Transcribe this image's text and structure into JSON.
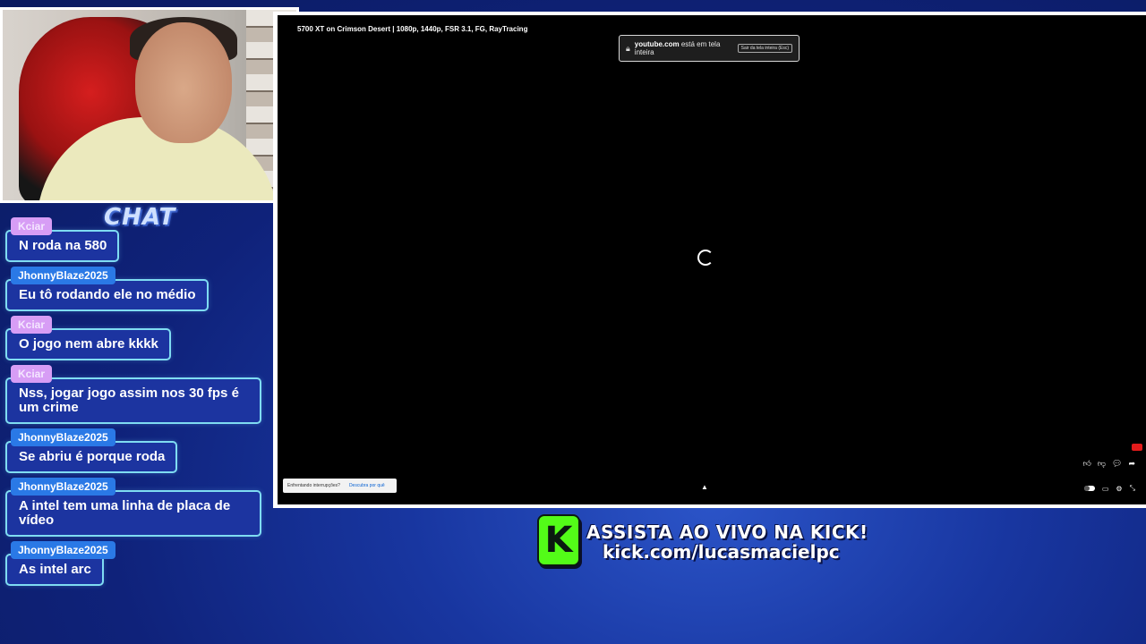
{
  "chat": {
    "title": "CHAT",
    "messages": [
      {
        "user": "Kciar",
        "text": "N roda na 580"
      },
      {
        "user": "JhonnyBlaze2025",
        "text": "Eu tô rodando ele no médio"
      },
      {
        "user": "Kciar",
        "text": "O jogo nem abre kkkk"
      },
      {
        "user": "Kciar",
        "text": "Nss, jogar jogo assim nos 30 fps é um crime"
      },
      {
        "user": "JhonnyBlaze2025",
        "text": "Se abriu é porque roda"
      },
      {
        "user": "JhonnyBlaze2025",
        "text": "A intel tem uma linha de placa de vídeo"
      },
      {
        "user": "JhonnyBlaze2025",
        "text": "As intel arc"
      }
    ]
  },
  "video": {
    "title": "5700 XT on Crimson Desert | 1080p, 1440p, FSR 3.1, FG, RayTracing",
    "fullscreen_notice": {
      "domain": "youtube.com",
      "message": "está em tela inteira",
      "exit_hint": "Sair da tela inteira (Esc)"
    },
    "interrupt_prompt": {
      "question": "Enfrentando interrupções?",
      "link": "Descubra por quê"
    }
  },
  "promo": {
    "line1": "ASSISTA AO VIVO NA KICK!",
    "line2": "kick.com/lucasmacielpc",
    "logo_letter": "K",
    "accent_color": "#53fc18"
  }
}
